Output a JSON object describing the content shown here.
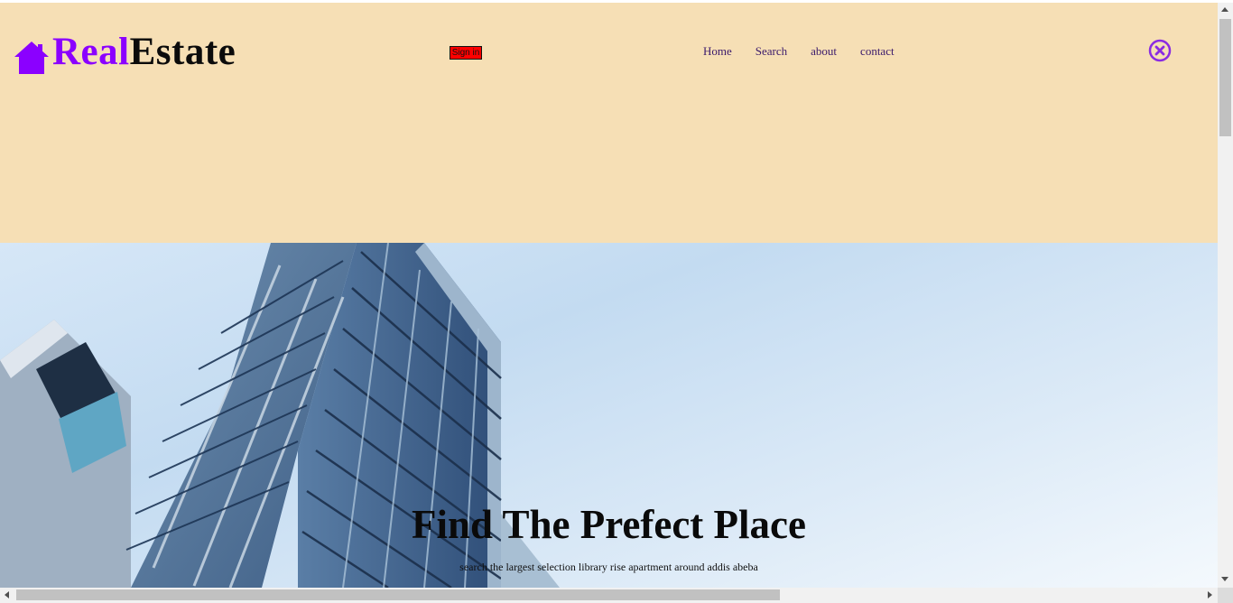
{
  "brand": {
    "part1": "Real",
    "part2": "Estate",
    "icon": "house-icon"
  },
  "header": {
    "signin_label": "Sign in"
  },
  "nav": {
    "items": [
      "Home",
      "Search",
      "about",
      "contact"
    ]
  },
  "close_icon": "close-circle-icon",
  "hero": {
    "title": "Find The Prefect Place",
    "subtitle": "search the largest selection library rise apartment around addis abeba",
    "image": "building-icon"
  },
  "colors": {
    "header_bg": "#f6dfb5",
    "brand_accent": "#8b00ff",
    "signin_bg": "#ff0000"
  }
}
